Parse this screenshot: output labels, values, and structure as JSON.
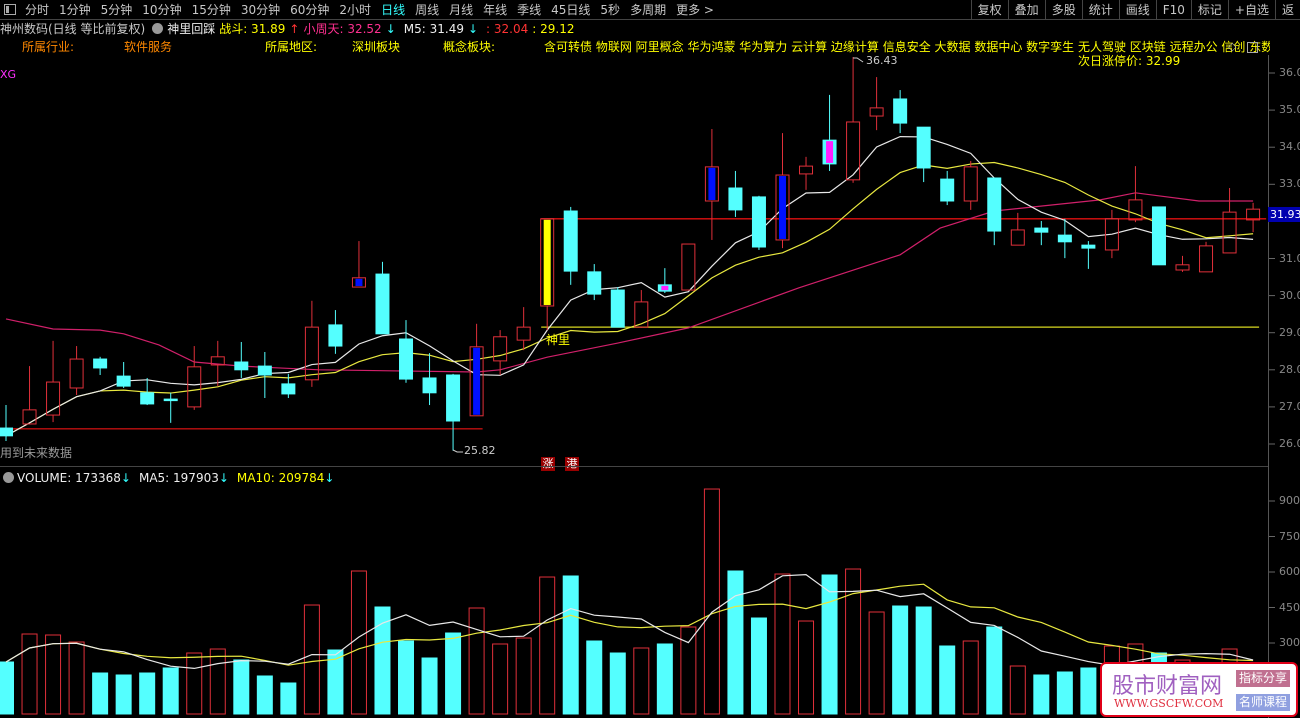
{
  "toolbar": {
    "periods": [
      "分时",
      "1分钟",
      "5分钟",
      "10分钟",
      "15分钟",
      "30分钟",
      "60分钟",
      "2小时",
      "日线",
      "周线",
      "月线",
      "年线",
      "季线",
      "45日线",
      "5秒",
      "多周期",
      "更多 >"
    ],
    "active_period": "日线",
    "right_buttons": [
      "复权",
      "叠加",
      "多股",
      "统计",
      "画线",
      "F10",
      "标记",
      "+自选",
      "返"
    ]
  },
  "info": {
    "stock": "神州数码(日线 等比前复权)",
    "indicator": "神里回踩",
    "zhandou": "战斗: 31.89",
    "zhandou_arrow": "↑",
    "xiaozhoutian": "小周天: 32.52",
    "xiaozhoutian_arrow": "↓",
    "m5": "M5: 31.49",
    "m5_arrow": "↓",
    "v1": ": 32.04",
    "v2": ": 29.12"
  },
  "profile": {
    "industry_label": "所属行业:",
    "industry": "软件服务",
    "region_label": "所属地区:",
    "region": "深圳板块",
    "concept_label": "概念板块:",
    "concepts": "含可转债 物联网 阿里概念 华为鸿蒙 华为算力 云计算 边缘计算 信息安全 大数据 数据中心 数字孪生 无人驾驶 区块链 远程办公 信创 东数西算 Cha",
    "limit_up": "次日涨停价: 32.99"
  },
  "labels": {
    "xg": "XG",
    "future": "用到未来数据",
    "shenli": "神里",
    "zhang": "涨",
    "gang": "港",
    "high_label": "36.43",
    "low_label": "25.82",
    "current_price": "31.93"
  },
  "volume_header": {
    "volume": "VOLUME: 173368",
    "ma5": "MA5: 197903",
    "ma10": "MA10: 209784",
    "arrow": "↓"
  },
  "watermark": {
    "name": "股市财富网",
    "url": "WWW.GSCFW.COM",
    "tag1": "指标分享",
    "tag2": "名师课程"
  },
  "colors": {
    "up": "#e0303a",
    "down": "#54ffff",
    "ma5": "#e8e8e8",
    "ma10": "#e8e840",
    "ma_long": "#d0206a",
    "blue": "#0010ff",
    "magenta": "#ff20ff",
    "yellow": "#ffff00"
  },
  "chart_data": [
    {
      "type": "candlestick",
      "title": "神州数码 日线",
      "ylim": [
        25.6,
        36.5
      ],
      "yticks": [
        "36.00",
        "35.00",
        "34.00",
        "33.00",
        "32.00",
        "31.00",
        "30.00",
        "29.00",
        "28.00",
        "27.00",
        "26.00"
      ],
      "candles": [
        [
          26.43,
          27.05,
          26.08,
          26.22
        ],
        [
          26.54,
          28.1,
          26.54,
          26.92
        ],
        [
          26.78,
          28.78,
          26.59,
          27.67
        ],
        [
          27.51,
          28.64,
          27.32,
          28.29
        ],
        [
          28.29,
          28.35,
          27.86,
          28.05
        ],
        [
          27.83,
          28.21,
          27.51,
          27.56
        ],
        [
          27.38,
          27.78,
          27.05,
          27.08
        ],
        [
          27.21,
          27.38,
          26.57,
          27.2
        ],
        [
          27.0,
          28.64,
          26.92,
          28.08
        ],
        [
          28.13,
          28.78,
          27.56,
          28.35
        ],
        [
          28.21,
          28.75,
          27.78,
          28.0
        ],
        [
          28.1,
          28.48,
          27.24,
          27.86
        ],
        [
          27.62,
          27.89,
          27.24,
          27.35
        ],
        [
          27.73,
          29.86,
          27.54,
          29.15
        ],
        [
          29.21,
          29.61,
          28.43,
          28.64
        ],
        [
          30.23,
          31.47,
          30.23,
          30.48
        ],
        [
          30.58,
          30.91,
          28.97,
          28.97
        ],
        [
          28.83,
          29.34,
          27.65,
          27.75
        ],
        [
          27.78,
          28.45,
          27.05,
          27.38
        ],
        [
          27.86,
          27.89,
          25.82,
          26.62
        ],
        [
          26.76,
          29.24,
          26.76,
          28.62
        ],
        [
          28.24,
          29.07,
          27.86,
          28.89
        ],
        [
          28.8,
          29.69,
          28.53,
          29.15
        ],
        [
          29.72,
          32.07,
          29.07,
          32.07
        ],
        [
          32.28,
          32.39,
          30.29,
          30.66
        ],
        [
          30.64,
          30.85,
          29.88,
          30.04
        ],
        [
          30.15,
          30.23,
          29.15,
          29.15
        ],
        [
          29.15,
          30.15,
          29.13,
          29.83
        ],
        [
          30.29,
          30.74,
          30.07,
          30.12
        ],
        [
          30.15,
          31.39,
          30.15,
          31.39
        ],
        [
          32.55,
          34.49,
          31.5,
          33.47
        ],
        [
          32.9,
          33.36,
          32.12,
          32.31
        ],
        [
          32.66,
          32.69,
          31.23,
          31.31
        ],
        [
          31.5,
          34.38,
          31.28,
          33.25
        ],
        [
          33.28,
          33.74,
          32.85,
          33.49
        ],
        [
          34.19,
          35.41,
          33.36,
          33.55
        ],
        [
          33.12,
          36.43,
          33.04,
          34.68
        ],
        [
          34.84,
          35.89,
          34.46,
          35.06
        ],
        [
          35.3,
          35.54,
          34.38,
          34.65
        ],
        [
          34.54,
          34.54,
          33.06,
          33.44
        ],
        [
          33.14,
          33.36,
          32.44,
          32.55
        ],
        [
          32.55,
          33.63,
          32.31,
          33.47
        ],
        [
          33.17,
          33.17,
          31.36,
          31.74
        ],
        [
          31.36,
          32.23,
          31.36,
          31.77
        ],
        [
          31.82,
          32.01,
          31.36,
          31.71
        ],
        [
          31.63,
          32.07,
          31.01,
          31.45
        ],
        [
          31.36,
          31.47,
          30.72,
          31.28
        ],
        [
          31.23,
          32.31,
          31.01,
          32.07
        ],
        [
          32.04,
          33.49,
          31.98,
          32.58
        ],
        [
          32.39,
          32.39,
          30.83,
          30.83
        ],
        [
          30.69,
          31.07,
          30.64,
          30.83
        ],
        [
          30.64,
          31.45,
          30.64,
          31.34
        ],
        [
          31.15,
          32.9,
          31.15,
          32.25
        ],
        [
          32.04,
          32.5,
          31.71,
          32.33
        ]
      ],
      "candle_fields": [
        "open",
        "high",
        "low",
        "close"
      ],
      "highlights": {
        "15": "blue",
        "20": "blue",
        "23": "yellow",
        "28": "magenta",
        "30": "blue",
        "33": "blue",
        "35": "magenta"
      },
      "ma_long": [
        [
          0,
          29.37
        ],
        [
          2,
          29.1
        ],
        [
          4,
          29.07
        ],
        [
          5,
          28.97
        ],
        [
          6.5,
          28.67
        ],
        [
          8,
          28.21
        ],
        [
          10,
          28.1
        ],
        [
          11.6,
          28.05
        ],
        [
          13.3,
          28.0
        ],
        [
          20,
          27.94
        ],
        [
          21,
          28.0
        ],
        [
          23,
          28.34
        ],
        [
          26,
          28.72
        ],
        [
          29,
          29.13
        ],
        [
          33.7,
          30.21
        ],
        [
          38,
          31.1
        ],
        [
          39.7,
          31.82
        ],
        [
          42,
          32.28
        ],
        [
          46.5,
          32.58
        ],
        [
          48,
          32.77
        ],
        [
          50.7,
          32.55
        ],
        [
          53,
          32.55
        ]
      ],
      "hlines": [
        {
          "price": 26.41,
          "from": 0,
          "to": 20,
          "color": "#c01010"
        },
        {
          "price": 32.07,
          "from": 23,
          "to": 53.3,
          "color": "#e01010"
        },
        {
          "price": 29.15,
          "from": 23,
          "to": 53,
          "color": "#d8d820"
        }
      ]
    },
    {
      "type": "bar",
      "title": "VOLUME",
      "ylim": [
        0,
        950000
      ],
      "yticks": [
        "900000",
        "750000",
        "600000",
        "450000",
        "300000"
      ],
      "values": [
        219700,
        338000,
        333800,
        304200,
        173200,
        164800,
        173200,
        194400,
        257700,
        274600,
        228200,
        160600,
        131000,
        460500,
        270400,
        604200,
        452100,
        308400,
        236600,
        342200,
        447900,
        295800,
        321100,
        578800,
        583100,
        308400,
        257700,
        278900,
        295800,
        367600,
        950600,
        604200,
        405600,
        591500,
        392900,
        587300,
        612600,
        431000,
        456300,
        452100,
        287300,
        308400,
        367600,
        202800,
        164800,
        177500,
        194400,
        287300,
        295800,
        257700,
        228000,
        207000,
        274600,
        173368
      ]
    }
  ]
}
